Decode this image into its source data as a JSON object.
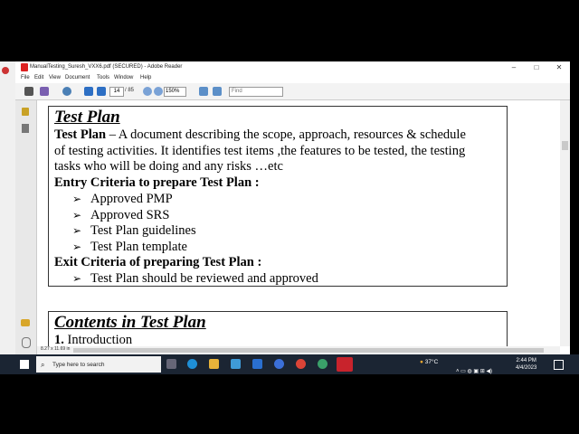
{
  "window": {
    "title": "ManualTesting_Suresh_VXX6.pdf (SECURED) - Adobe Reader",
    "controls": [
      "–",
      "□",
      "✕"
    ]
  },
  "menu": [
    "File",
    "Edit",
    "View",
    "Document",
    "Tools",
    "Window",
    "Help"
  ],
  "toolbar": {
    "page_current": "14",
    "page_total": "/ 85",
    "zoom": "150%",
    "find_placeholder": "Find"
  },
  "document": {
    "section1": {
      "heading": "Test Plan",
      "definition_term": "Test Plan",
      "definition_lines": [
        " – A document describing the scope, approach, resources & schedule",
        "of testing activities. It identifies test items ,the features to be tested, the testing",
        "tasks who will be doing and any risks …etc"
      ],
      "entry_heading": "Entry Criteria to prepare Test Plan :",
      "entry_items": [
        "Approved PMP",
        "Approved SRS",
        "Test Plan guidelines",
        "Test Plan template"
      ],
      "exit_heading": "Exit Criteria of preparing Test Plan :",
      "exit_items": [
        "Test Plan should be reviewed and approved"
      ]
    },
    "section2": {
      "heading": "Contents in Test Plan",
      "item_number": "1.",
      "item_text": " Introduction"
    },
    "page_size": "8.27 x 11.69 in"
  },
  "taskbar": {
    "search_placeholder": "Type here to search",
    "weather": "37°C",
    "time": "2:44 PM",
    "date": "4/4/2023"
  }
}
